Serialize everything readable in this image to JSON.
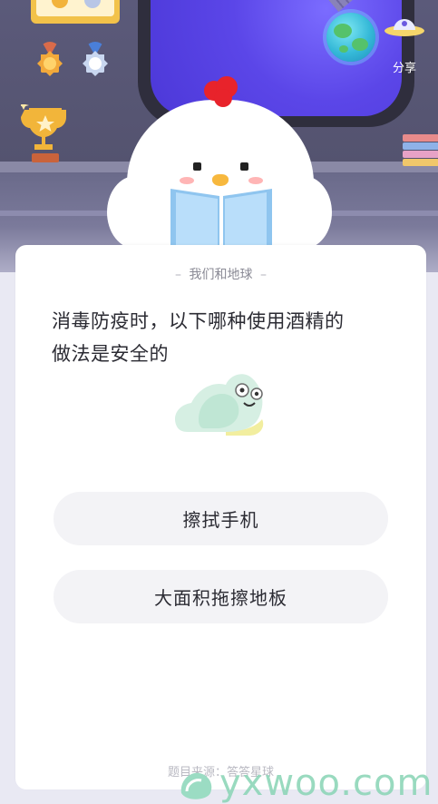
{
  "scene": {
    "share_label": "分享"
  },
  "card": {
    "header_left_dash": "–",
    "header": "我们和地球",
    "header_right_dash": "–",
    "question_line1": "消毒防疫时，以下哪种使用酒精的",
    "question_line2": "做法是安全的",
    "options": [
      {
        "label": "擦拭手机"
      },
      {
        "label": "大面积拖擦地板"
      }
    ],
    "source": "题目来源：答答星球"
  },
  "watermark": {
    "text": "yxwoo.com"
  },
  "colors": {
    "accent_purple": "#5b46e8",
    "option_bg": "#f3f3f6",
    "watermark": "#8fd6b9"
  },
  "icons": [
    "trophy-icon",
    "medal-icon",
    "globe-icon",
    "share-ufo-icon",
    "satellite-icon",
    "books-icon",
    "chick-mascot",
    "snail-icon"
  ]
}
